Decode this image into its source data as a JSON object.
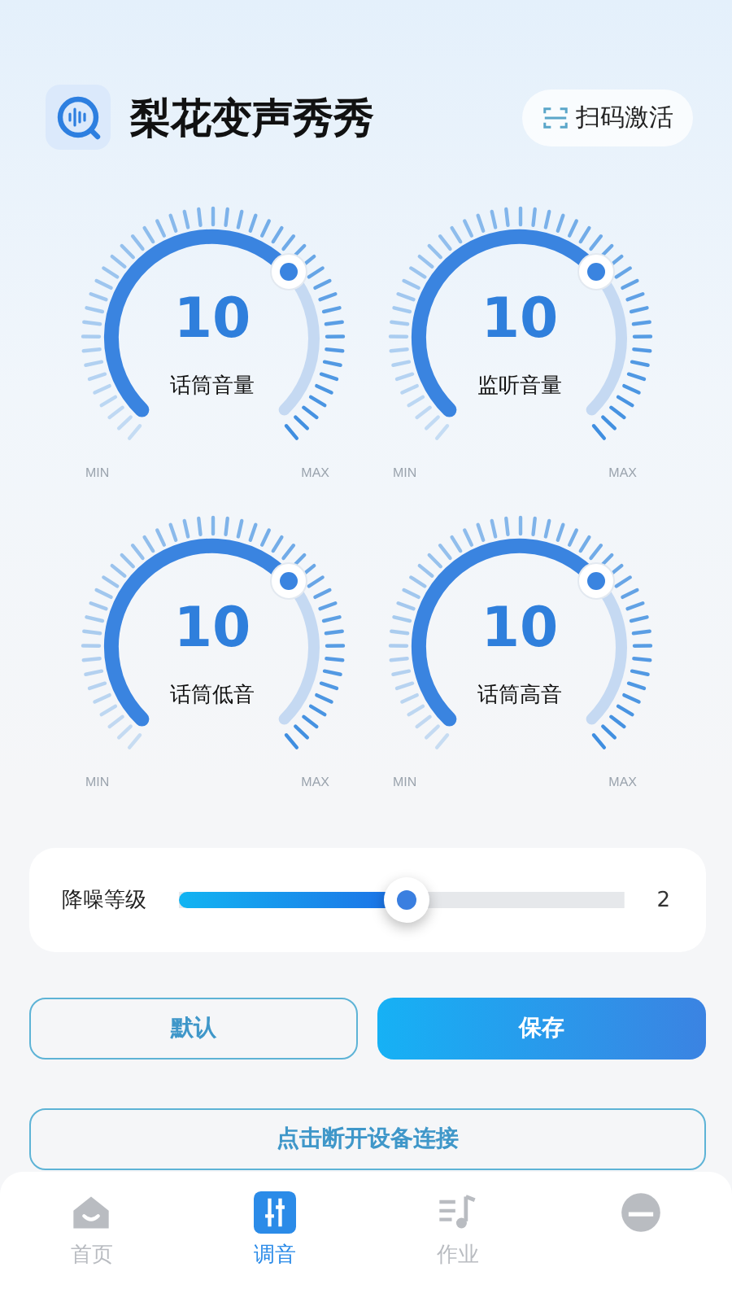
{
  "header": {
    "title": "梨花变声秀秀",
    "scan_button": "扫码激活"
  },
  "dials": [
    {
      "value": "10",
      "label": "话筒音量",
      "min": "MIN",
      "max": "MAX"
    },
    {
      "value": "10",
      "label": "监听音量",
      "min": "MIN",
      "max": "MAX"
    },
    {
      "value": "10",
      "label": "话筒低音",
      "min": "MIN",
      "max": "MAX"
    },
    {
      "value": "10",
      "label": "话筒高音",
      "min": "MIN",
      "max": "MAX"
    }
  ],
  "noise": {
    "label": "降噪等级",
    "level": 0.51,
    "reading": "2"
  },
  "buttons": [
    {
      "label": "默认",
      "kind": "outline"
    },
    {
      "label": "保存",
      "kind": "primary"
    }
  ],
  "disconnect_button": "点击断开设备连接",
  "tabs": [
    {
      "label": "首页",
      "selected": false
    },
    {
      "label": "调音",
      "selected": true
    },
    {
      "label": "作业",
      "selected": false
    },
    {
      "selected": false
    }
  ]
}
